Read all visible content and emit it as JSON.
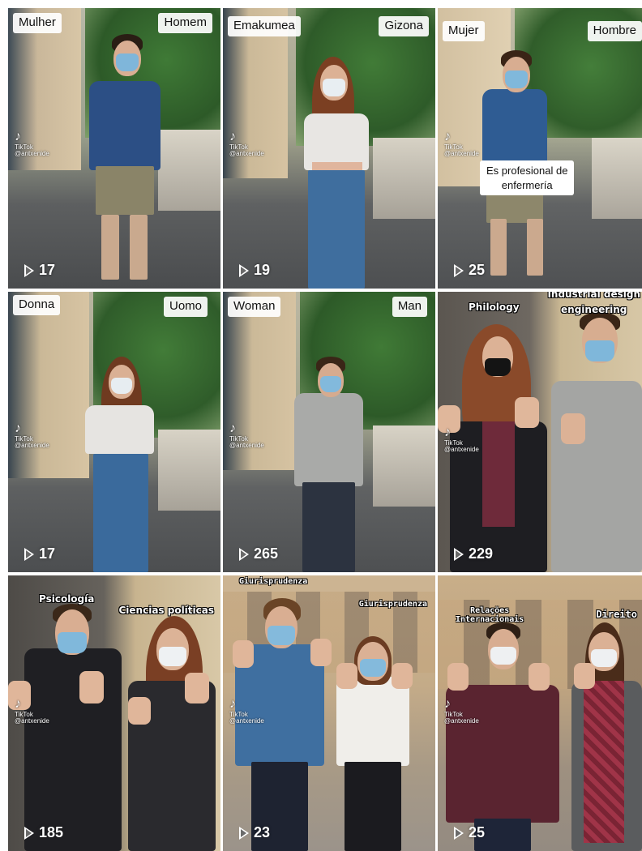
{
  "tiles": [
    {
      "labels": [
        "Mulher",
        "Homem"
      ],
      "caption": "",
      "views": "17",
      "watermark": {
        "brand": "TikTok",
        "handle": "@antxenide"
      }
    },
    {
      "labels": [
        "Emakumea",
        "Gizona"
      ],
      "caption": "",
      "views": "19",
      "watermark": {
        "brand": "TikTok",
        "handle": "@antxenide"
      }
    },
    {
      "labels": [
        "Mujer",
        "Hombre"
      ],
      "caption": "Es profesional de\nenfermería",
      "views": "25",
      "watermark": {
        "brand": "TikTok",
        "handle": "@antxenide"
      }
    },
    {
      "labels": [
        "Donna",
        "Uomo"
      ],
      "caption": "",
      "views": "17",
      "watermark": {
        "brand": "TikTok",
        "handle": "@antxenide"
      }
    },
    {
      "labels": [
        "Woman",
        "Man"
      ],
      "caption": "",
      "views": "265",
      "watermark": {
        "brand": "TikTok",
        "handle": "@antxenide"
      }
    },
    {
      "labels": [
        "Philology",
        "Industrial design\nengineering"
      ],
      "caption": "",
      "views": "229",
      "watermark": {
        "brand": "TikTok",
        "handle": "@antxenide"
      }
    },
    {
      "labels": [
        "Psicología",
        "Ciencias políticas"
      ],
      "caption": "",
      "views": "185",
      "watermark": {
        "brand": "TikTok",
        "handle": "@antxenide"
      }
    },
    {
      "labels": [
        "Giurisprudenza",
        "Giurisprudenza"
      ],
      "caption": "",
      "views": "23",
      "watermark": {
        "brand": "TikTok",
        "handle": "@antxenide"
      }
    },
    {
      "labels": [
        "Relações\nInternacionais",
        "Direito"
      ],
      "caption": "",
      "views": "25",
      "watermark": {
        "brand": "TikTok",
        "handle": "@antxenide"
      }
    }
  ],
  "icons": {
    "play": "play-icon",
    "tiktok": "tiktok-logo-icon"
  },
  "colors": {
    "label_bg": "#ffffff",
    "views_text": "#ffffff"
  }
}
